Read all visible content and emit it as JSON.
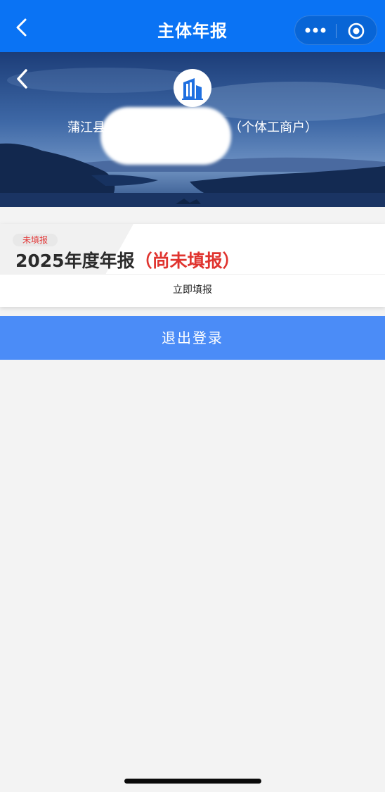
{
  "navbar": {
    "title": "主体年报",
    "background": "#0a73f4"
  },
  "banner": {
    "entity_name": "蒲江县",
    "entity_type": "（个体工商户）"
  },
  "report_card": {
    "status_badge": "未填报",
    "year_label": "2025年度年报",
    "status_label": "（尚未填报）",
    "action_label": "立即填报",
    "status_color": "#e0342f"
  },
  "logout": {
    "label": "退出登录",
    "background": "#4b8cf7"
  },
  "icons": {
    "nav_back": "chevron-left-icon",
    "capsule_more": "more-dots-icon",
    "capsule_close": "target-circle-icon",
    "banner_back": "chevron-left-icon",
    "logo": "building-icon"
  }
}
